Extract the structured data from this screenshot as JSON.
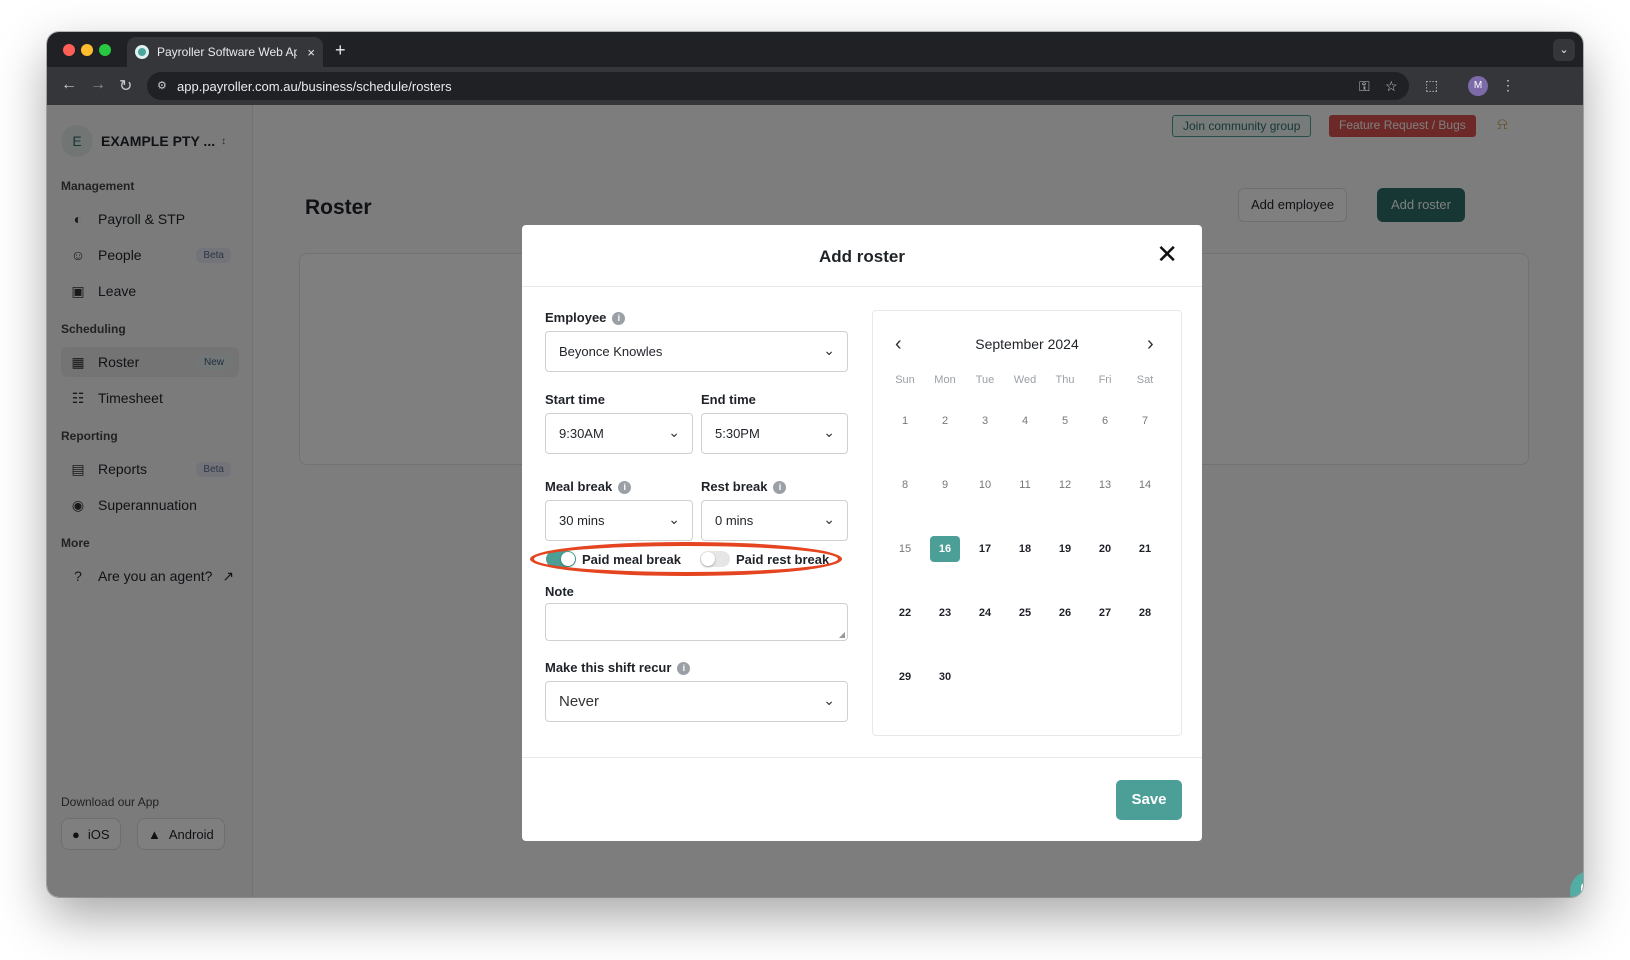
{
  "browser": {
    "tab_title": "Payroller Software Web Application",
    "tab_close": "×",
    "new_tab": "+",
    "url": "app.payroller.com.au/business/schedule/rosters",
    "profile_initial": "M"
  },
  "org": {
    "initial": "E",
    "name": "EXAMPLE PTY ..."
  },
  "sidebar": {
    "sections": [
      {
        "title": "Management"
      },
      {
        "title": "Scheduling"
      },
      {
        "title": "Reporting"
      },
      {
        "title": "More"
      }
    ],
    "items": [
      {
        "label": "Payroll & STP",
        "icon": "payroll-icon"
      },
      {
        "label": "People",
        "badge": "Beta",
        "icon": "people-icon"
      },
      {
        "label": "Leave",
        "icon": "briefcase-icon"
      },
      {
        "label": "Roster",
        "badge": "New",
        "icon": "calendar-icon",
        "active": true
      },
      {
        "label": "Timesheet",
        "icon": "clipboard-icon"
      },
      {
        "label": "Reports",
        "badge": "Beta",
        "icon": "report-icon"
      },
      {
        "label": "Superannuation",
        "icon": "piggy-bank-icon"
      },
      {
        "label": "Are you an agent?",
        "icon": "help-icon"
      }
    ],
    "download_title": "Download our App",
    "ios_label": "iOS",
    "android_label": "Android"
  },
  "header": {
    "community_label": "Join community group",
    "feature_label": "Feature Request / Bugs",
    "page_title": "Roster",
    "add_employee_label": "Add employee",
    "add_roster_label": "Add roster"
  },
  "modal": {
    "title": "Add roster",
    "employee_label": "Employee",
    "employee_value": "Beyonce Knowles",
    "start_time_label": "Start time",
    "start_time_value": "9:30AM",
    "end_time_label": "End time",
    "end_time_value": "5:30PM",
    "meal_break_label": "Meal break",
    "meal_break_value": "30 mins",
    "rest_break_label": "Rest break",
    "rest_break_value": "0 mins",
    "paid_meal_label": "Paid meal break",
    "paid_rest_label": "Paid rest break",
    "note_label": "Note",
    "recur_label": "Make this shift recur",
    "recur_value": "Never",
    "save_label": "Save"
  },
  "calendar": {
    "month": "September 2024",
    "weekdays": [
      "Sun",
      "Mon",
      "Tue",
      "Wed",
      "Thu",
      "Fri",
      "Sat"
    ],
    "days": [
      "1",
      "2",
      "3",
      "4",
      "5",
      "6",
      "7",
      "8",
      "9",
      "10",
      "11",
      "12",
      "13",
      "14",
      "15",
      "16",
      "17",
      "18",
      "19",
      "20",
      "21",
      "22",
      "23",
      "24",
      "25",
      "26",
      "27",
      "28",
      "29",
      "30"
    ],
    "selected_day": "16"
  },
  "colors": {
    "brand": "#2e6f6a",
    "accent": "#4b9f96",
    "highlight": "#e4441f"
  }
}
